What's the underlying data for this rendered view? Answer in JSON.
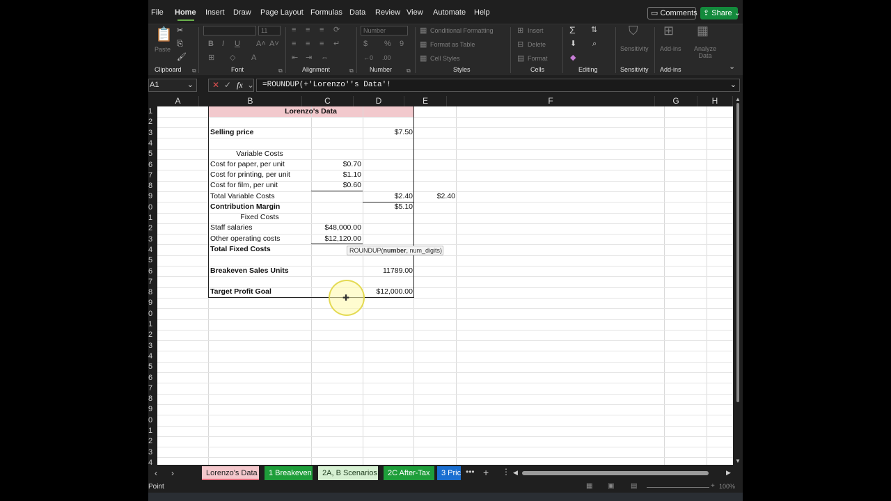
{
  "menu": {
    "items": [
      "File",
      "Home",
      "Insert",
      "Draw",
      "Page Layout",
      "Formulas",
      "Data",
      "Review",
      "View",
      "Automate",
      "Help"
    ],
    "active": "Home",
    "comments_label": "Comments",
    "share_label": "Share"
  },
  "ribbon": {
    "groups": [
      "Clipboard",
      "Font",
      "Alignment",
      "Number",
      "Styles",
      "Cells",
      "Editing",
      "Sensitivity",
      "Add-ins"
    ],
    "paste_label": "Paste",
    "font_size": "11",
    "number_format": "Number",
    "conditional_formatting": "Conditional Formatting",
    "format_as_table": "Format as Table",
    "cell_styles": "Cell Styles",
    "insert": "Insert",
    "delete": "Delete",
    "format": "Format",
    "sensitivity": "Sensitivity",
    "addins": "Add-ins",
    "analyze_data": "Analyze Data"
  },
  "formula_bar": {
    "name_box": "A1",
    "fx": "fx",
    "formula": "=ROUNDUP(+'Lorenzo''s Data'!"
  },
  "grid": {
    "columns": [
      "A",
      "B",
      "C",
      "D",
      "E",
      "F",
      "G",
      "H"
    ],
    "row_numbers": [
      "1",
      "2",
      "3",
      "4",
      "5",
      "6",
      "7",
      "8",
      "9",
      "0",
      "1",
      "2",
      "3",
      "4",
      "5",
      "6",
      "7",
      "8",
      "9",
      "0",
      "1",
      "2",
      "3",
      "4",
      "5",
      "6",
      "7",
      "8",
      "9",
      "0",
      "1",
      "2",
      "3",
      "4"
    ],
    "title": "Lorenzo's Data",
    "rows": {
      "selling_price": {
        "label": "Selling price",
        "d": "$7.50"
      },
      "variable_costs_header": "Variable Costs",
      "paper": {
        "label": "Cost for paper, per unit",
        "c": "$0.70"
      },
      "printing": {
        "label": "Cost for printing, per unit",
        "c": "$1.10"
      },
      "film": {
        "label": "Cost for film, per unit",
        "c": "$0.60"
      },
      "total_variable": {
        "label": "Total Variable Costs",
        "d": "$2.40",
        "e": "$2.40"
      },
      "contribution_margin": {
        "label": "Contribution Margin",
        "d": "$5.10"
      },
      "fixed_costs_header": "Fixed Costs",
      "staff": {
        "label": "Staff salaries",
        "c": "$48,000.00"
      },
      "other_operating": {
        "label": "Other operating costs",
        "c": "$12,120.00"
      },
      "total_fixed": {
        "label": "Total Fixed Costs"
      },
      "breakeven": {
        "label": "Breakeven Sales Units",
        "d": "11789.00"
      },
      "target_profit": {
        "label": "Target Profit Goal",
        "d": "$12,000.00"
      }
    },
    "tooltip": {
      "fn": "ROUNDUP(",
      "arg1": "number",
      "rest": ", num_digits)"
    }
  },
  "sheet_tabs": [
    {
      "label": "Lorenzo's Data",
      "bg": "#f4c7cc",
      "fg": "#222222"
    },
    {
      "label": "1 Breakeven",
      "bg": "#1e9e3a",
      "fg": "#ffffff"
    },
    {
      "label": "2A, B Scenarios",
      "bg": "#d6f0d2",
      "fg": "#1f3d1f"
    },
    {
      "label": "2C After-Tax",
      "bg": "#1e9e3a",
      "fg": "#ffffff"
    },
    {
      "label": "3 Pric",
      "bg": "#1a6fd1",
      "fg": "#ffffff"
    }
  ],
  "status": {
    "mode": "Point",
    "zoom": "100%"
  },
  "colors": {
    "accent_green": "#138a3c",
    "title_band": "#f2c9cd"
  }
}
